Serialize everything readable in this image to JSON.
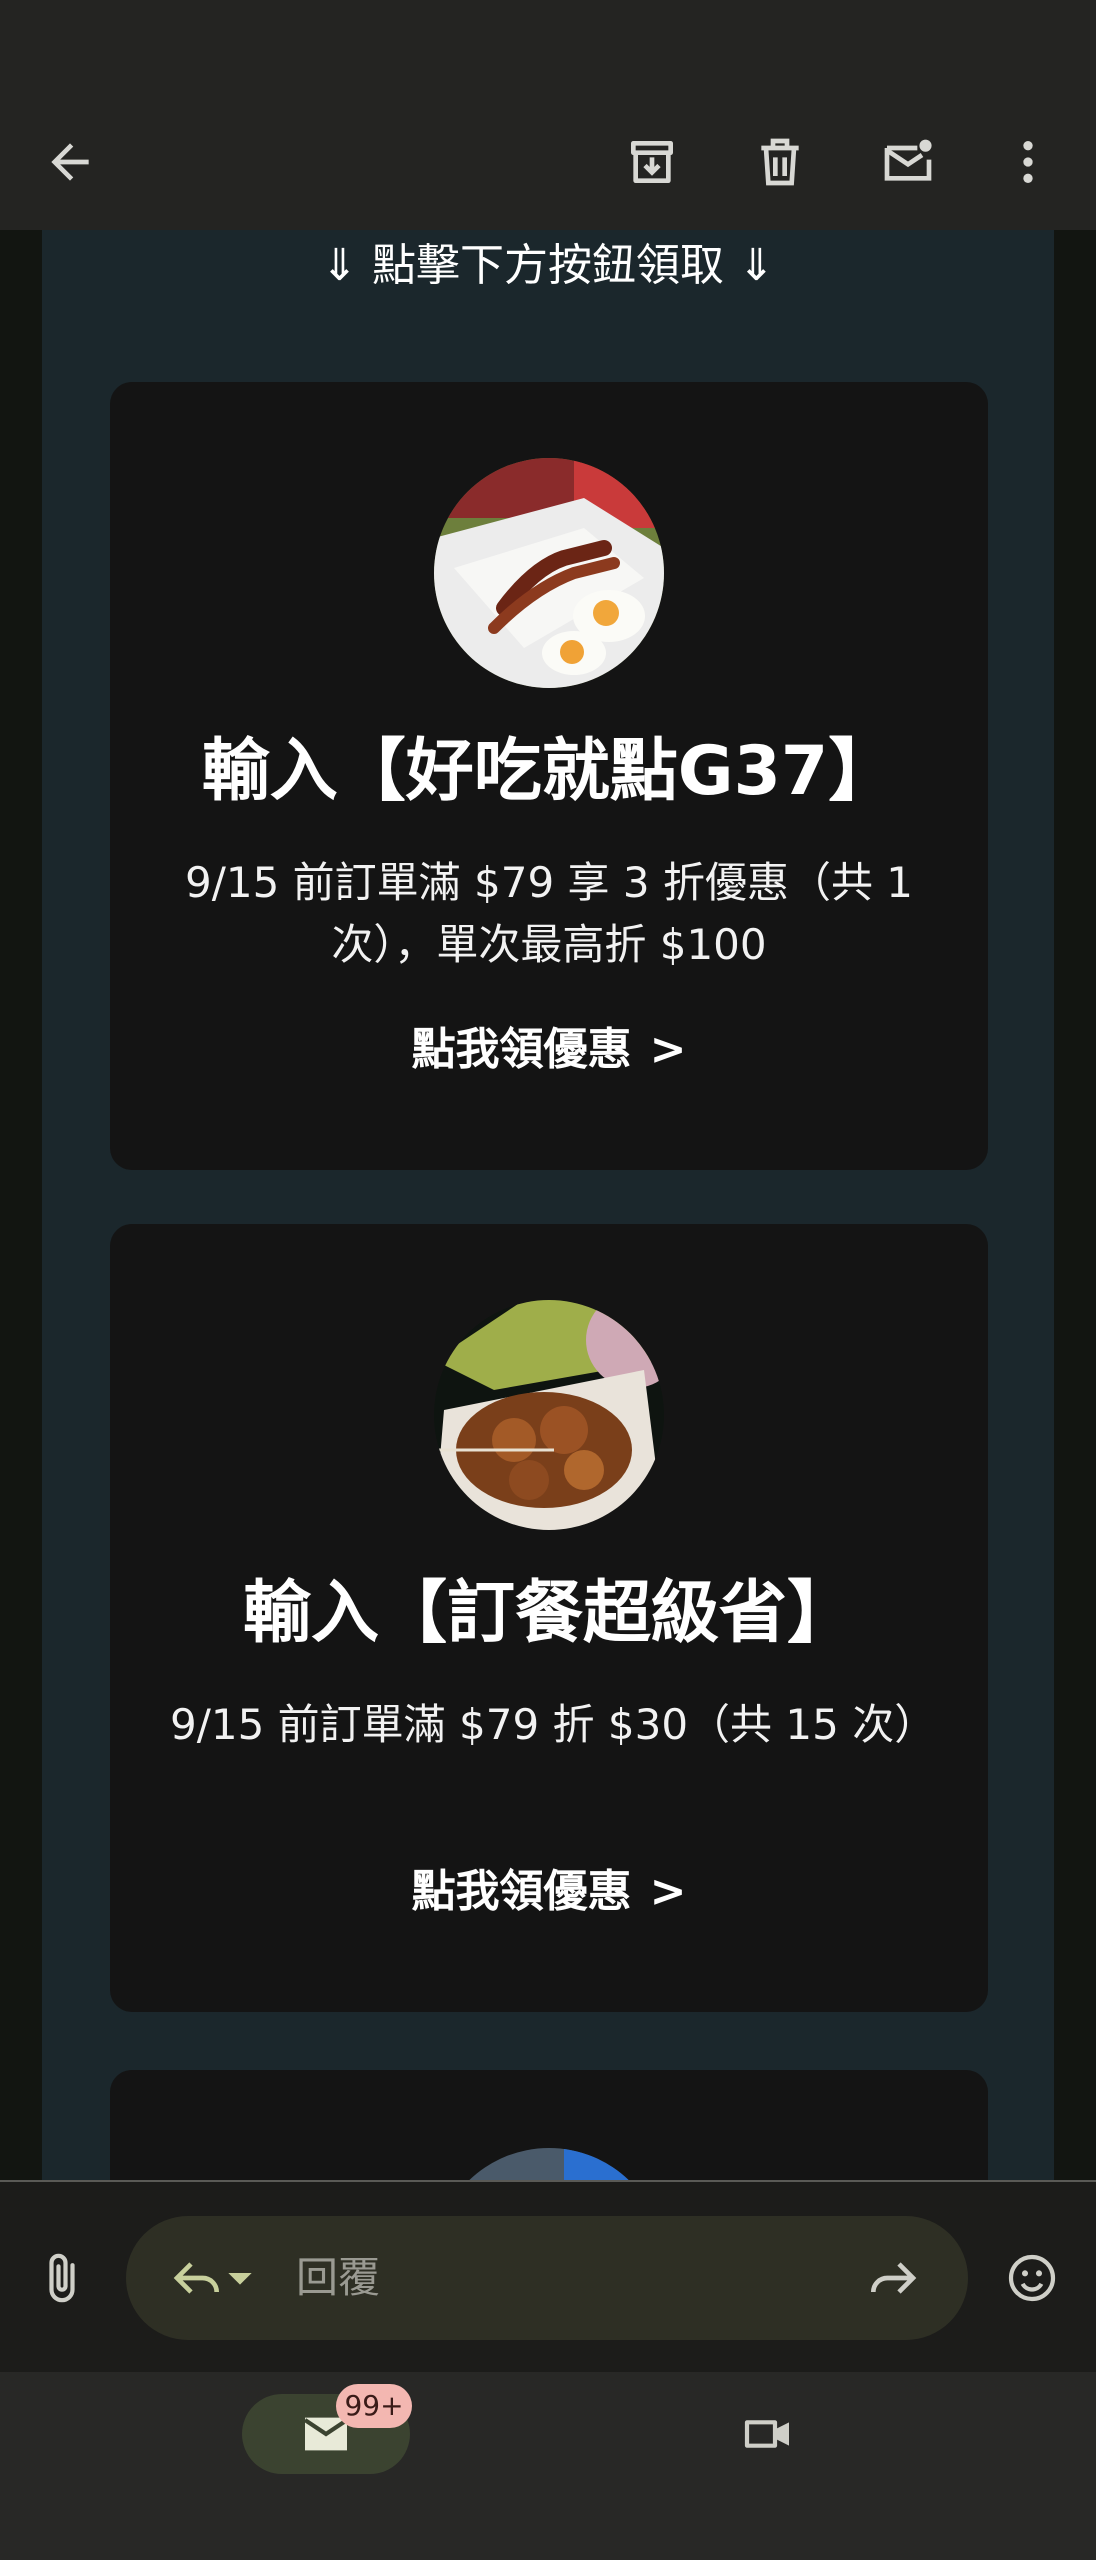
{
  "toolbar": {
    "back_icon": "arrow-left-icon",
    "archive_icon": "archive-icon",
    "delete_icon": "trash-icon",
    "mark_unread_icon": "mail-unread-icon",
    "more_icon": "more-vert-icon"
  },
  "email": {
    "intro_text": "⇓ 點擊下方按鈕領取 ⇓",
    "coupons": [
      {
        "image": "bacon-eggs-photo",
        "title": "輸入【好吃就點G37】",
        "description": "9/15 前訂單滿 $79 享 3 折優惠（共 1 次），單次最高折 $100",
        "cta": "點我領優惠",
        "cta_arrow": ">"
      },
      {
        "image": "fried-chicken-photo",
        "title": "輸入【訂餐超級省】",
        "description": "9/15 前訂單滿 $79 折 $30（共 15 次）",
        "cta": "點我領優惠",
        "cta_arrow": ">"
      }
    ]
  },
  "compose": {
    "attach_icon": "paperclip-icon",
    "reply_icon": "reply-icon",
    "reply_dropdown_icon": "caret-down-icon",
    "reply_placeholder": "回覆",
    "forward_icon": "forward-icon",
    "emoji_icon": "emoji-icon"
  },
  "bottom_nav": {
    "mail_icon": "mail-icon",
    "mail_badge": "99+",
    "meet_icon": "video-camera-icon"
  },
  "colors": {
    "app_bar": "#242422",
    "email_body_bg": "#1b272c",
    "card_bg": "#141414",
    "reply_pill": "#2e2f24",
    "nav_active": "#3b4330",
    "badge": "#f3b7b1"
  }
}
